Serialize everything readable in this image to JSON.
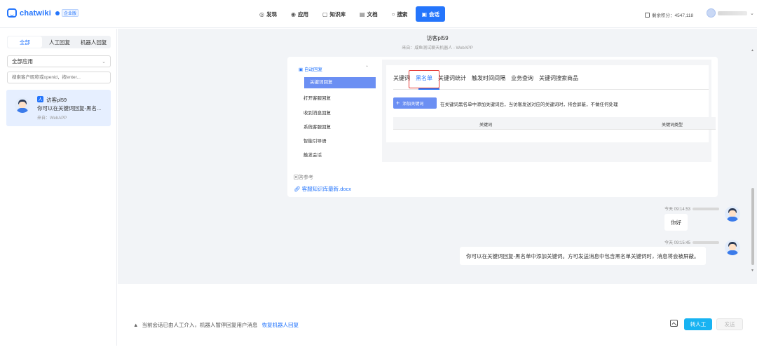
{
  "header": {
    "logo_text": "chatwiki",
    "edition": "企业版",
    "nav": [
      {
        "label": "发现",
        "icon": "compass-icon",
        "glyph": "◎"
      },
      {
        "label": "应用",
        "icon": "apps-icon",
        "glyph": "◉"
      },
      {
        "label": "知识库",
        "icon": "book-icon",
        "glyph": "▢"
      },
      {
        "label": "文档",
        "icon": "document-icon",
        "glyph": "▤"
      },
      {
        "label": "搜索",
        "icon": "search-icon",
        "glyph": "○"
      },
      {
        "label": "会话",
        "icon": "chat-icon",
        "glyph": "▣"
      }
    ],
    "active_nav": "会话",
    "credits_text": "剩余积分：4547,118",
    "accent_color": "#2475fc"
  },
  "sidebar": {
    "tabs": [
      "全部",
      "人工回复",
      "机器人回复"
    ],
    "active_tab": "全部",
    "app_select": "全部应用",
    "search_placeholder": "搜索客户昵称或openid，按enter...",
    "session": {
      "badge": "人",
      "name": "访客pl59",
      "last_message": "你可以在关键词回复-黑名...",
      "source": "来自：WebAPP"
    }
  },
  "chat": {
    "title": "访客pl59",
    "subtitle": "来自：咸鱼测试聊天机器人 - WebAPP",
    "card": {
      "group_label": "自动回复",
      "menu": [
        "关键词回复",
        "打开客服回复",
        "收到消息回复",
        "系统客服回复",
        "智能引导语",
        "触发会话"
      ],
      "active_menu": "关键词回复",
      "tabs": [
        "关键词",
        "黑名单",
        "关键词统计",
        "触发时间间隔",
        "业务查询",
        "关键词搜索商品"
      ],
      "highlighted_tab": "黑名单",
      "add_button": "添加关键词",
      "add_desc": "在关键词黑名单中添加关键词后，当访客发送对应的关键词时，将会屏蔽，不做任何处理",
      "table_headers": [
        "关键词",
        "关键词类型"
      ],
      "ref_label": "回答参考",
      "ref_file": "客服知识库最新.docx"
    },
    "messages": [
      {
        "time": "今天 09:14:53",
        "text": "你好"
      },
      {
        "time": "今天 09:15:45",
        "text": "你可以在关键词回复-黑名单中添加关键词。方可发送消息中包含黑名单关键词时，消息将会被屏蔽。"
      }
    ]
  },
  "composer": {
    "notice": "当前会话已由人工介入，机器人暂停回复用户消息",
    "restore_link": "恢复机器人回复",
    "transfer_button": "转人工",
    "send_button": "发送"
  }
}
